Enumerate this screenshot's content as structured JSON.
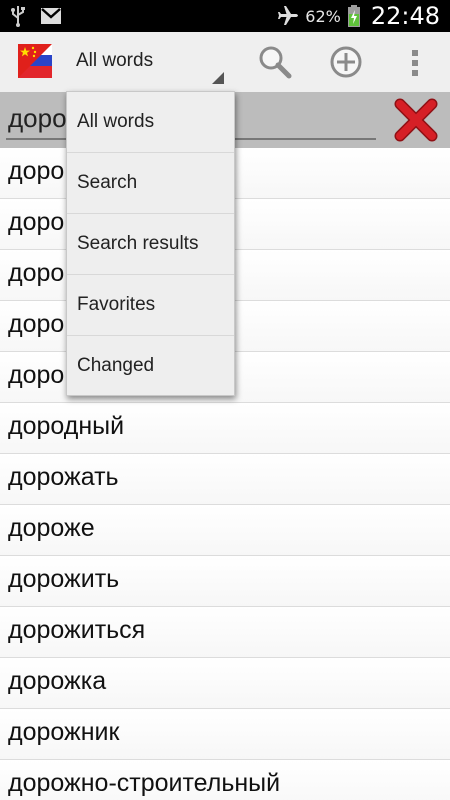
{
  "status_bar": {
    "icons": [
      "usb-icon",
      "gmail-icon",
      "airplane-icon",
      "battery-charging-icon"
    ],
    "battery_percent": "62%",
    "time": "22:48"
  },
  "action_bar": {
    "flag_icon": "china-russia-flag-icon",
    "filter_selected": "All words",
    "actions": [
      "search-icon",
      "add-icon",
      "overflow-menu-icon"
    ]
  },
  "search": {
    "value": "доро",
    "clear_icon": "red-x-icon"
  },
  "filter_menu": {
    "options": [
      "All words",
      "Search",
      "Search results",
      "Favorites",
      "Changed"
    ]
  },
  "word_list": {
    "items": [
      "доро",
      "доро",
      "доро",
      "доро",
      "доро",
      "дородный",
      "дорожать",
      "дороже",
      "дорожить",
      "дорожиться",
      "дорожка",
      "дорожник",
      "дорожно-строительный"
    ]
  },
  "colors": {
    "status_bar_bg": "#000000",
    "action_bar_bg": "#efefef",
    "search_row_bg": "#bcbcbc",
    "clear_red": "#d61f26",
    "battery_green": "#5fc13a"
  }
}
